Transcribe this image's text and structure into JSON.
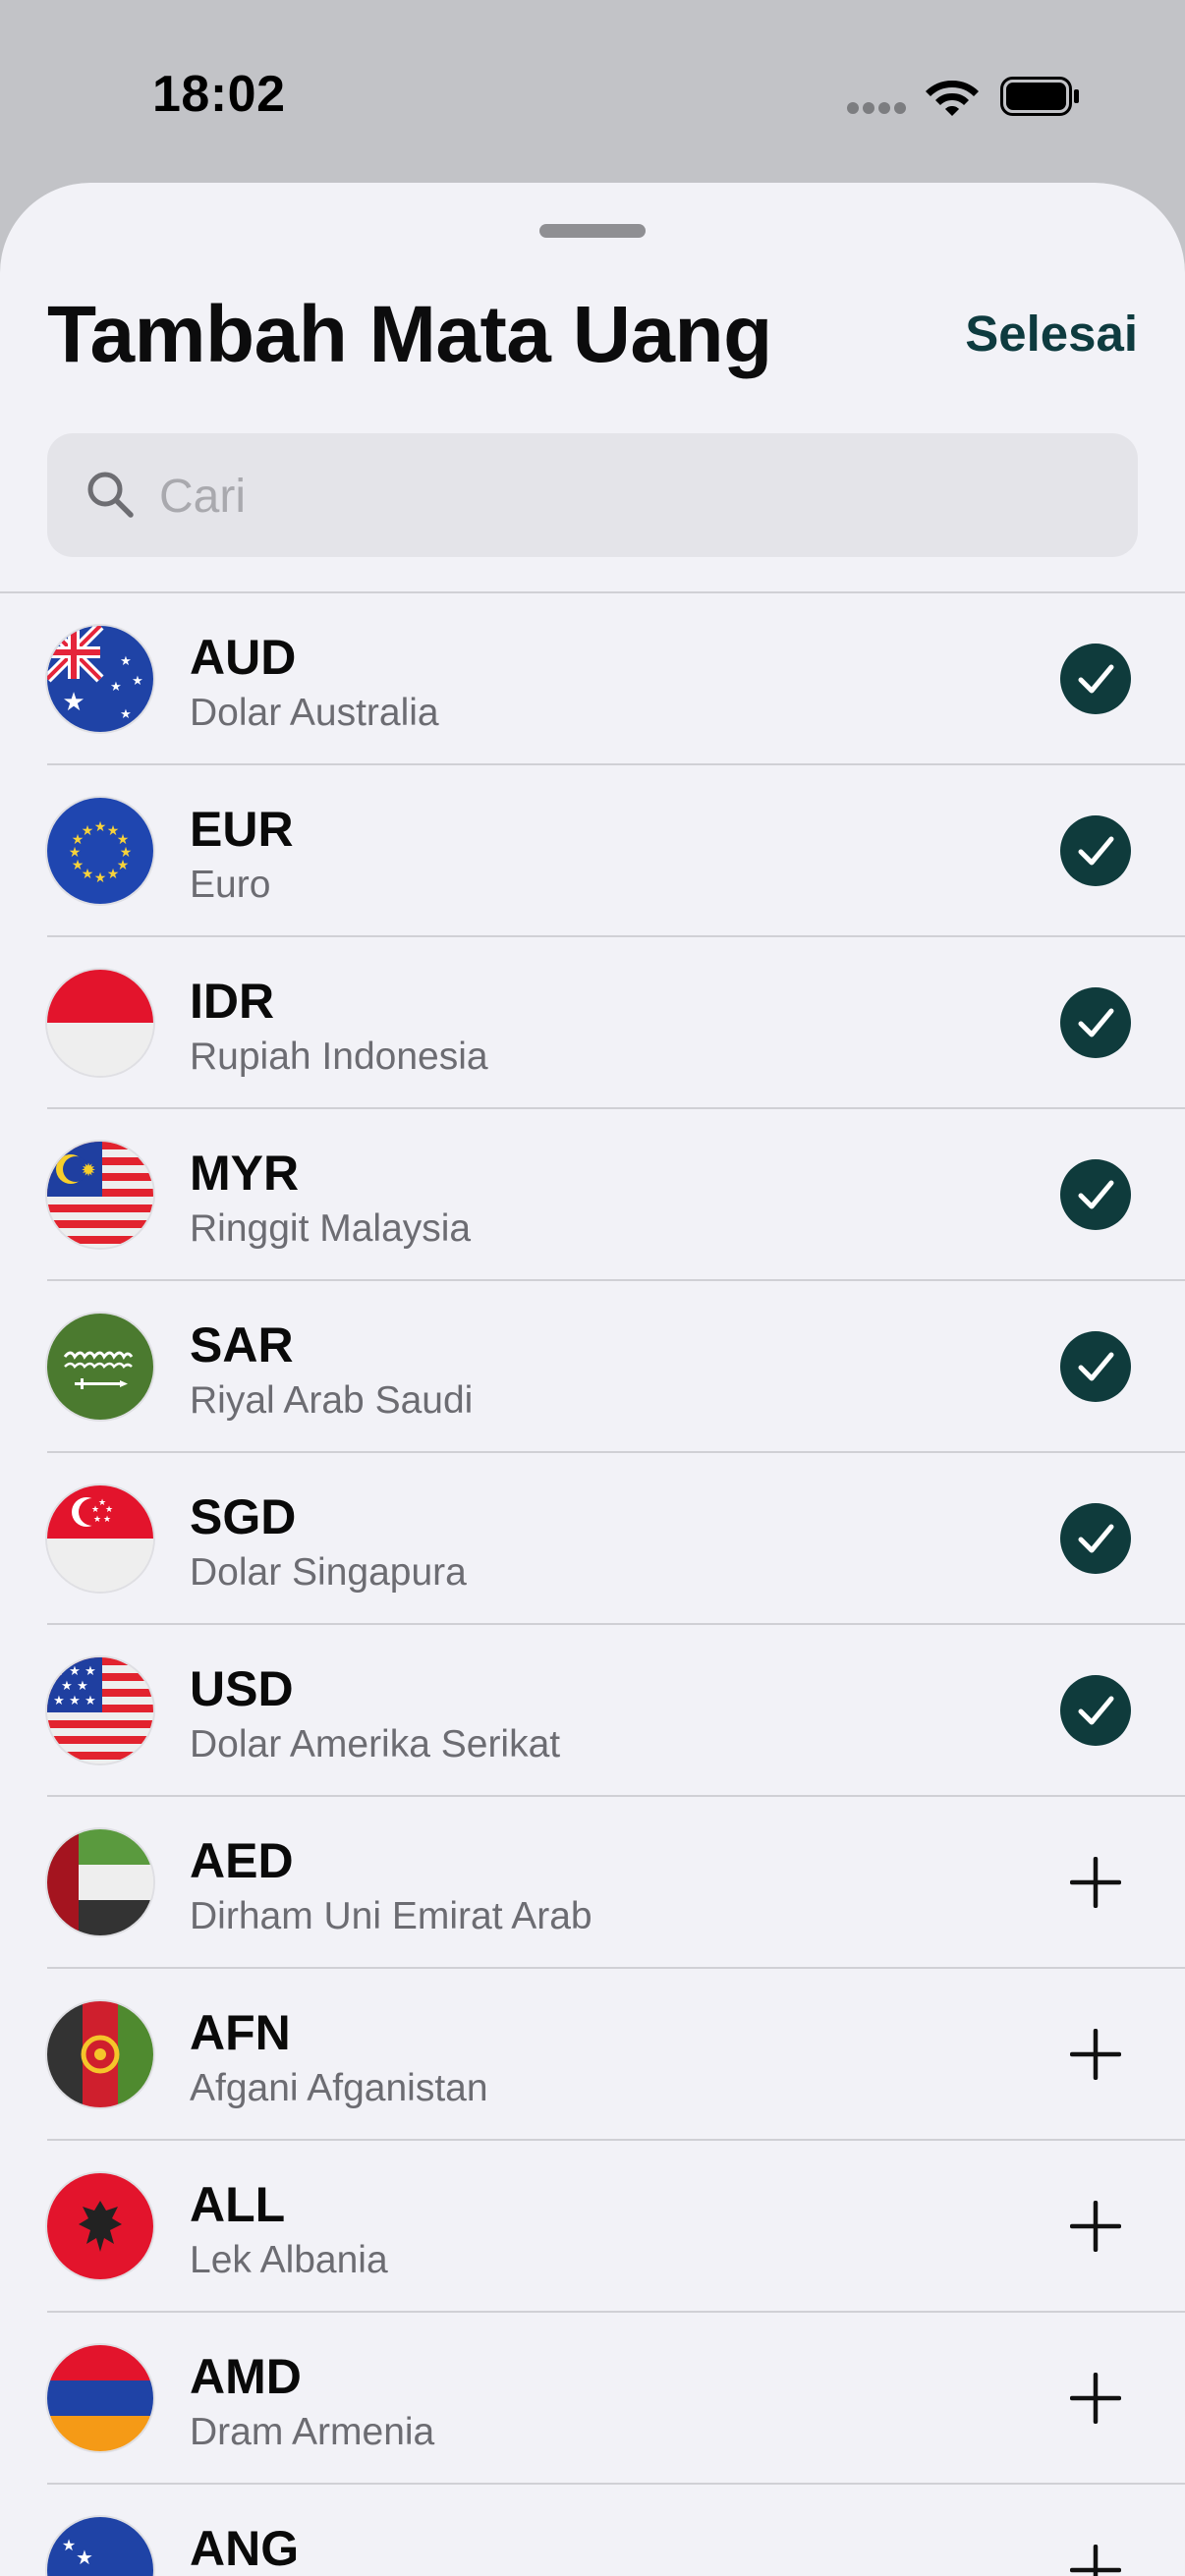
{
  "status_bar": {
    "time": "18:02"
  },
  "header": {
    "title": "Tambah Mata Uang",
    "done_label": "Selesai"
  },
  "search": {
    "placeholder": "Cari",
    "value": ""
  },
  "currencies": [
    {
      "code": "AUD",
      "name": "Dolar Australia",
      "selected": true
    },
    {
      "code": "EUR",
      "name": "Euro",
      "selected": true
    },
    {
      "code": "IDR",
      "name": "Rupiah Indonesia",
      "selected": true
    },
    {
      "code": "MYR",
      "name": "Ringgit Malaysia",
      "selected": true
    },
    {
      "code": "SAR",
      "name": "Riyal Arab Saudi",
      "selected": true
    },
    {
      "code": "SGD",
      "name": "Dolar Singapura",
      "selected": true
    },
    {
      "code": "USD",
      "name": "Dolar Amerika Serikat",
      "selected": true
    },
    {
      "code": "AED",
      "name": "Dirham Uni Emirat Arab",
      "selected": false
    },
    {
      "code": "AFN",
      "name": "Afgani Afganistan",
      "selected": false
    },
    {
      "code": "ALL",
      "name": "Lek Albania",
      "selected": false
    },
    {
      "code": "AMD",
      "name": "Dram Armenia",
      "selected": false
    },
    {
      "code": "ANG",
      "name": "",
      "selected": false
    }
  ],
  "colors": {
    "accent": "#0f3b3c",
    "sheet_background": "#f2f2f7",
    "secondary_text": "#6c6c72"
  },
  "icons": {
    "selected": "checkmark-circle-icon",
    "unselected": "plus-icon"
  }
}
